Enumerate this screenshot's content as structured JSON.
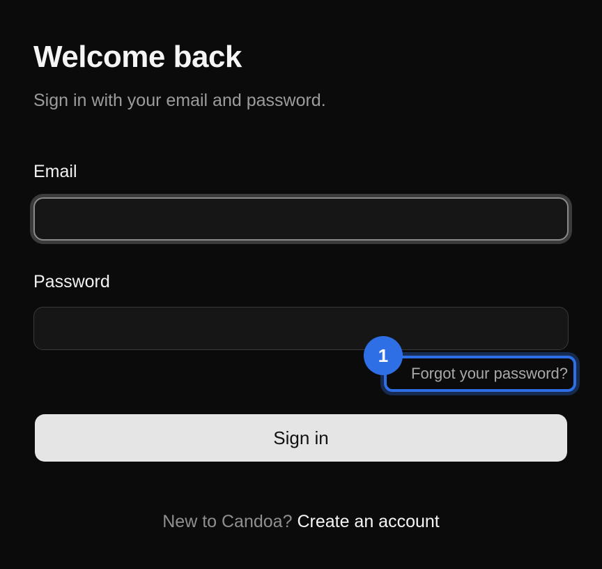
{
  "header": {
    "title": "Welcome back",
    "subtitle": "Sign in with your email and password."
  },
  "form": {
    "email_label": "Email",
    "email_value": "",
    "email_placeholder": "",
    "password_label": "Password",
    "password_value": "",
    "password_placeholder": "",
    "forgot_password_label": "Forgot your password?",
    "annotation_marker": "1",
    "submit_label": "Sign in"
  },
  "footer": {
    "prompt_text": "New to Candoa?",
    "create_account_label": "Create an account"
  },
  "colors": {
    "background": "#0b0b0b",
    "highlight": "#2f6fe6",
    "button_bg": "#e5e5e5"
  }
}
